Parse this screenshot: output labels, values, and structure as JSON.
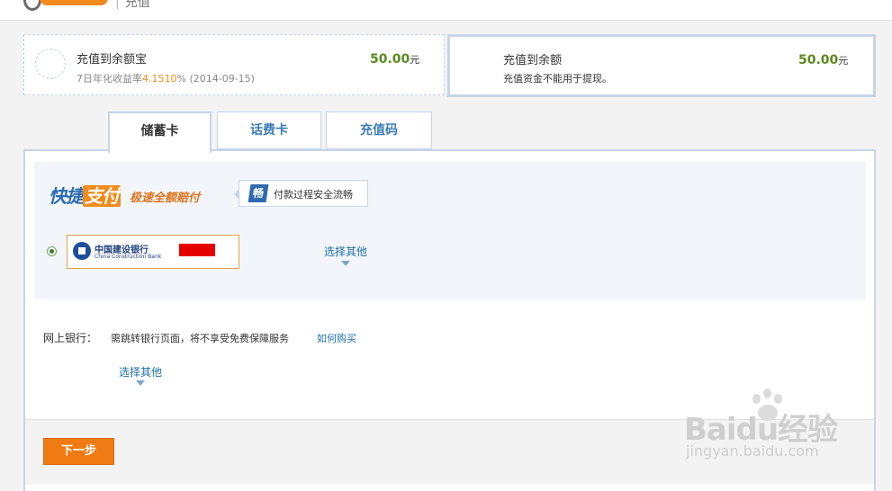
{
  "header": {
    "page_title": "充值"
  },
  "options": {
    "yuebao": {
      "title": "充值到余额宝",
      "sub_prefix": "7日年化收益率",
      "rate": "4.1510",
      "sub_suffix": "% (2014-09-15)",
      "amount": "50.00",
      "unit": "元"
    },
    "balance": {
      "title": "充值到余额",
      "sub": "充值资金不能用于提现。",
      "amount": "50.00",
      "unit": "元"
    }
  },
  "tabs": [
    {
      "label": "储蓄卡",
      "active": true
    },
    {
      "label": "话费卡",
      "active": false
    },
    {
      "label": "充值码",
      "active": false
    }
  ],
  "quickpay": {
    "logo_part1": "快捷",
    "logo_part2": "支付",
    "slogan": "极速全额赔付",
    "badge_icon_text": "畅",
    "badge_text": "付款过程安全流畅",
    "bank_name_cn": "中国建设银行",
    "bank_name_en": "China Construction Bank",
    "choose_other": "选择其他"
  },
  "netbank": {
    "label": "网上银行：",
    "note": "需跳转银行页面，将不享受免费保障服务",
    "link": "如何购买",
    "choose_other": "选择其他"
  },
  "actions": {
    "next": "下一步"
  },
  "watermark": {
    "brand": "Baidu经验",
    "url": "jingyan.baidu.com"
  },
  "colors": {
    "accent_orange": "#f07b14",
    "link_blue": "#1b6fa8",
    "amount_green": "#5a8a1e",
    "border_blue": "#c6d5e7"
  }
}
